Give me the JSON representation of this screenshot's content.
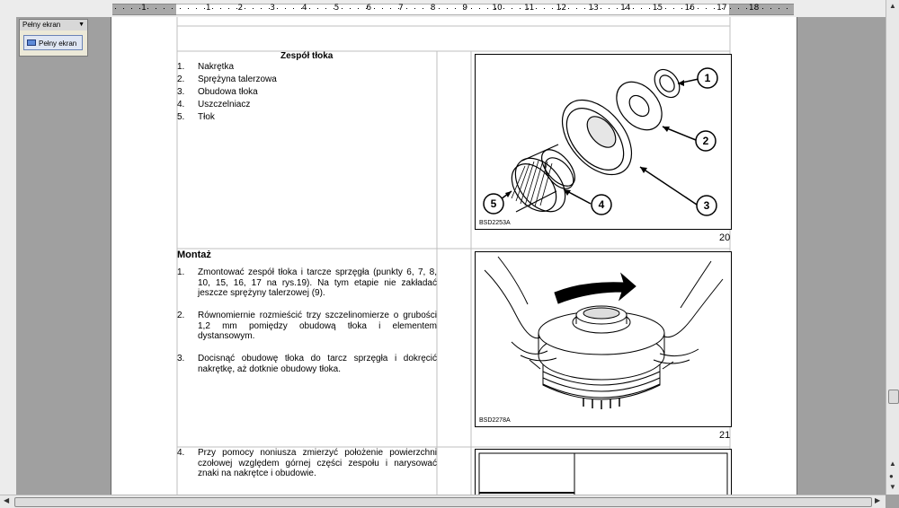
{
  "toolbar": {
    "title": "Pełny ekran",
    "button_label": "Pełny ekran"
  },
  "ruler": {
    "numbers": [
      "1",
      "1",
      "2",
      "3",
      "4",
      "5",
      "6",
      "7",
      "8",
      "9",
      "10",
      "11",
      "12",
      "13",
      "14",
      "15",
      "16",
      "17",
      "18"
    ]
  },
  "section1": {
    "title": "Zespół tłoka",
    "items": [
      {
        "num": "1.",
        "text": "Nakrętka"
      },
      {
        "num": "2.",
        "text": "Sprężyna talerzowa"
      },
      {
        "num": "3.",
        "text": "Obudowa tłoka"
      },
      {
        "num": "4.",
        "text": "Uszczelniacz"
      },
      {
        "num": "5.",
        "text": "Tłok"
      }
    ],
    "figure_code": "BSD2253A",
    "figure_number": "20",
    "callouts": [
      "1",
      "2",
      "3",
      "4",
      "5"
    ]
  },
  "section2": {
    "title": "Montaż",
    "steps": [
      {
        "num": "1.",
        "text": "Zmontować zespół tłoka i tarcze sprzęgła (punkty 6, 7, 8, 10, 15, 16, 17 na rys.19). Na tym etapie nie zakładać jeszcze sprężyny talerzowej (9)."
      },
      {
        "num": "2.",
        "text": "Równomiernie rozmieścić trzy szczelinomierze o grubości 1,2 mm pomiędzy obudową tłoka i elementem dystansowym."
      },
      {
        "num": "3.",
        "text": "Docisnąć obudowę tłoka do tarcz sprzęgła i dokręcić nakrętkę, aż dotknie obudowy tłoka."
      }
    ],
    "figure_code": "BSD2278A",
    "figure_number": "21"
  },
  "section3": {
    "steps": [
      {
        "num": "4.",
        "text": "Przy pomocy noniusza zmierzyć położenie powierzchni czołowej względem górnej części zespołu i narysować znaki na nakrętce i obudowie."
      }
    ]
  }
}
